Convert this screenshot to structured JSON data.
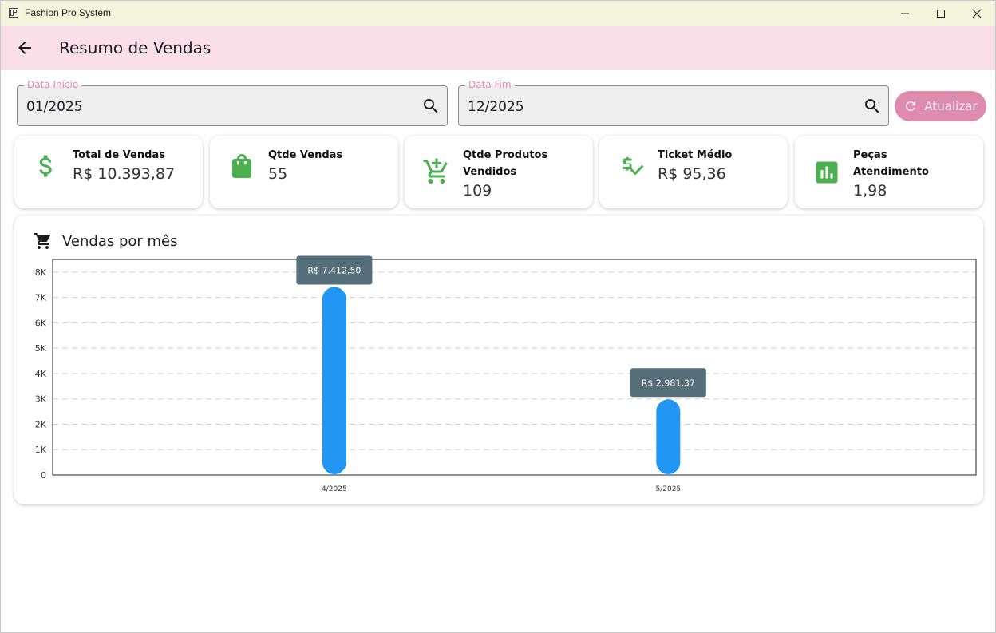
{
  "window": {
    "title": "Fashion Pro System"
  },
  "appbar": {
    "title": "Resumo de Vendas"
  },
  "filters": {
    "start": {
      "label": "Data Início",
      "value": "01/2025"
    },
    "end": {
      "label": "Data Fim",
      "value": "12/2025"
    },
    "refresh_label": "Atualizar"
  },
  "stats": {
    "total_sales": {
      "label": "Total de Vendas",
      "value": "R$ 10.393,87",
      "icon": "dollar-icon"
    },
    "sales_count": {
      "label": "Qtde Vendas",
      "value": "55",
      "icon": "shopping-bag-icon"
    },
    "products_sold": {
      "label_line1": "Qtde Produtos",
      "label_line2": "Vendidos",
      "value": "109",
      "icon": "cart-add-icon"
    },
    "avg_ticket": {
      "label": "Ticket Médio",
      "value": "R$ 95,36",
      "icon": "price-check-icon"
    },
    "pieces_per_service": {
      "label_line1": "Peças",
      "label_line2": "Atendimento",
      "value": "1,98",
      "icon": "bar-chart-icon"
    }
  },
  "colors": {
    "accent_green": "#4caf50",
    "bar_blue": "#2196f3",
    "tooltip_bg": "#546e7a",
    "appbar_bg": "#fadfe9",
    "button_pink": "#de8cae"
  },
  "chart": {
    "title": "Vendas por mês",
    "icon": "shopping-cart-icon"
  },
  "chart_data": {
    "type": "bar",
    "categories": [
      "4/2025",
      "5/2025"
    ],
    "values": [
      7412.5,
      2981.37
    ],
    "value_labels": [
      "R$ 7.412,50",
      "R$ 2.981,37"
    ],
    "ylim": [
      0,
      8500
    ],
    "yticks": [
      0,
      1000,
      2000,
      3000,
      4000,
      5000,
      6000,
      7000,
      8000
    ],
    "ytick_labels": [
      "0",
      "1K",
      "2K",
      "3K",
      "4K",
      "5K",
      "6K",
      "7K",
      "8K"
    ],
    "grid": true
  }
}
